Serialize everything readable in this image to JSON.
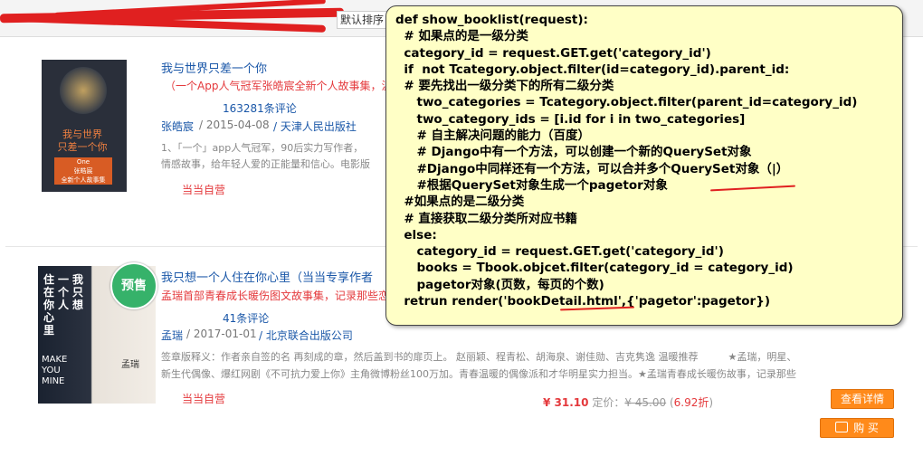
{
  "toolbar": {
    "sort_label": "默认排序"
  },
  "books": [
    {
      "title": "我与世界只差一个你",
      "subtitle": "（一个App人气冠军张皓宸全新个人故事集，温",
      "reviews": "163281条评论",
      "author": "张皓宸",
      "date": "/ 2015-04-08",
      "publisher": "/ 天津人民出版社",
      "desc_line1": "1、「一个」app人气冠军，90后实力写作者，",
      "desc_line2": "情感故事，给年轻人爱的正能量和信心。电影版",
      "seller": "当当自营",
      "cover_title": "我与世界\n只差一个你",
      "cover_subtitle": "One\n张皓宸\n全新个人故事集"
    },
    {
      "title": "我只想一个人住在你心里（当当专享作者",
      "subtitle": "孟瑞首部青春成长暖伤图文故事集，记录那些恋",
      "reviews": "41条评论",
      "author": "孟瑞",
      "date": "/ 2017-01-01",
      "publisher": "/ 北京联合出版公司",
      "desc_line1": "签章版释义：作者亲自签的名 再刻成的章，然后盖到书的扉页上。 赵丽颖、程青松、胡海泉、谢佳勋、吉克隽逸 温暖推荐　　　★孟瑞，明星、",
      "desc_line2": "新生代偶像、爆红网剧《不可抗力爱上你》主角微博粉丝100万加。青春温暖的偶像派和才华明星实力担当。★孟瑞青春成长暖伤故事，记录那些",
      "seller": "当当自营",
      "badge": "预售",
      "price": "¥ 31.10",
      "price_label": "定价：",
      "list_price": "¥ 45.00",
      "discount_value": "6.92折",
      "detail_button": "查看详情",
      "buy_button": "购 买",
      "cover_vertical_1": "我只想",
      "cover_vertical_2": "一个人",
      "cover_vertical_3": "住在你心里",
      "cover_en": "MAKE\nYOU\nMINE",
      "cover_author": "孟瑞"
    }
  ],
  "code_note": {
    "lines": [
      "def show_booklist(request):",
      "  # 如果点的是一级分类",
      "  category_id = request.GET.get('category_id')",
      "  if  not Tcategory.object.filter(id=category_id).parent_id:",
      "  # 要先找出一级分类下的所有二级分类",
      "     two_categories = Tcategory.object.filter(parent_id=category_id)",
      "     two_category_ids = [i.id for i in two_categories]",
      "     # 自主解决问题的能力（百度）",
      "     # Django中有一个方法，可以创建一个新的QuerySet对象",
      "     #Django中同样还有一个方法，可以合并多个QuerySet对象（|）",
      "     #根据QuerySet对象生成一个pagetor对象",
      "  #如果点的是二级分类",
      "  # 直接获取二级分类所对应书籍",
      "  else:",
      "     category_id = request.GET.get('category_id')",
      "     books = Tbook.objcet.filter(category_id = category_id)",
      "     pagetor对象(页数，每页的个数)",
      "  retrun render('bookDetail.html',{'pagetor':pagetor})"
    ]
  }
}
